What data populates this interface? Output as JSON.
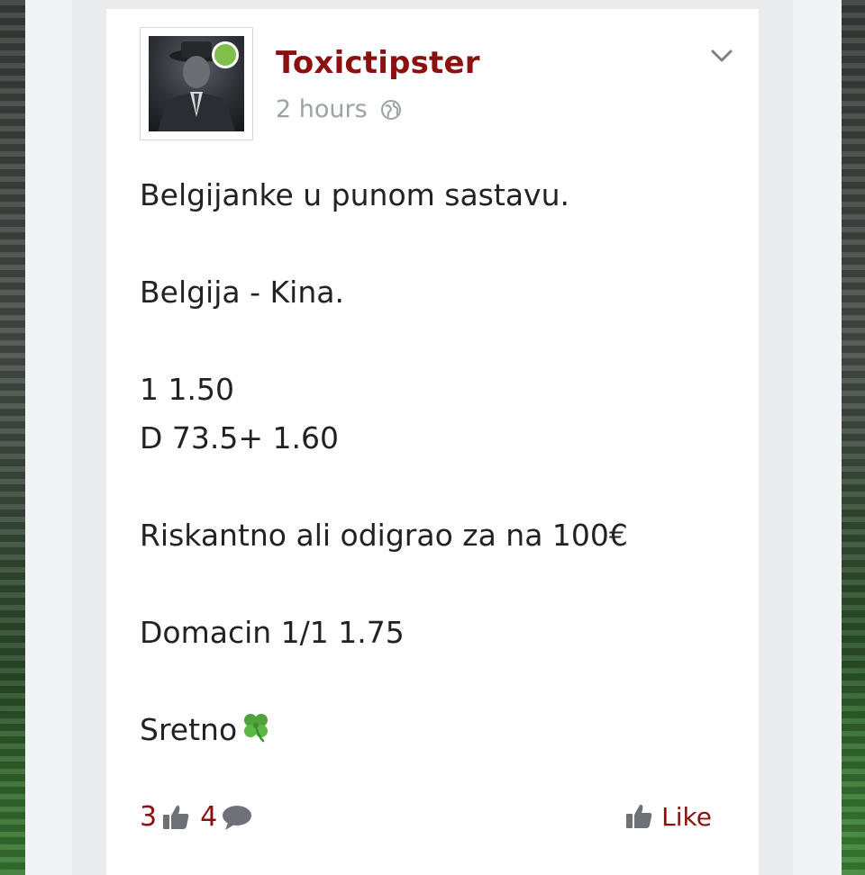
{
  "post": {
    "author": "Toxictipster",
    "time": "2 hours",
    "lines": [
      "Belgijanke u punom sastavu.",
      "",
      "Belgija - Kina.",
      "",
      "1 1.50",
      "D 73.5+ 1.60",
      "",
      "Riskantno ali odigrao za na 100€",
      "",
      "Domacin 1/1 1.75",
      "",
      "Sretno"
    ],
    "reactions_count": "3",
    "comments_count": "4",
    "like_label": "Like"
  },
  "icons": {
    "online": "online-status-dot",
    "visibility": "globe-icon",
    "menu": "chevron-down-icon",
    "reaction": "thumbs-up-icon",
    "comment": "comment-bubble-icon",
    "emoji": "four-leaf-clover-emoji"
  },
  "colors": {
    "brand": "#8b1010",
    "online": "#7fc04a",
    "meta": "#9aa3a6",
    "icon": "#6e7276"
  }
}
